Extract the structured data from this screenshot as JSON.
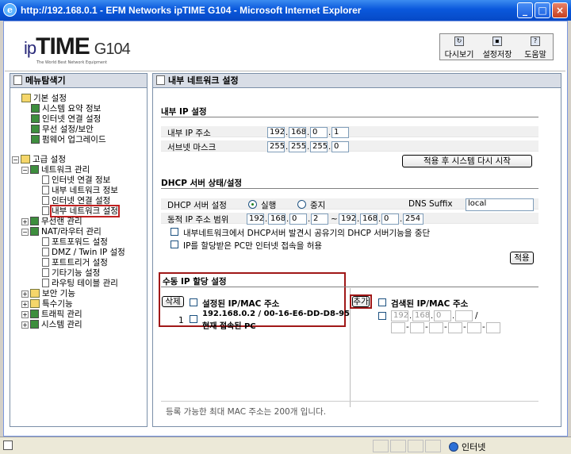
{
  "window": {
    "title": "http://192.168.0.1 - EFM Networks ipTIME G104 - Microsoft Internet Explorer"
  },
  "header": {
    "logo_prefix": "ip",
    "logo_main": "TIME",
    "logo_model": "G104",
    "logo_tagline": "The World Best Network Equipment",
    "buttons": [
      {
        "label": "다시보기"
      },
      {
        "label": "설정저장"
      },
      {
        "label": "도움말"
      }
    ]
  },
  "sidebar": {
    "title": "메뉴탐색기",
    "basic": {
      "label": "기본 설정",
      "items": [
        "시스템 요약 정보",
        "인터넷 연결 설정",
        "무선 설정/보안",
        "펌웨어 업그레이드"
      ]
    },
    "advanced": {
      "label": "고급 설정"
    },
    "network": {
      "label": "네트워크 관리",
      "items": [
        "인터넷 연결 정보",
        "내부 네트워크 정보",
        "인터넷 연결 설정",
        "내부 네트워크 설정"
      ]
    },
    "groups": [
      "무선랜 관리",
      "NAT/라우터 관리"
    ],
    "nat_items": [
      "포트포워드 설정",
      "DMZ / Twin IP 설정",
      "포트트리거 설정",
      "기타기능 설정",
      "라우팅 테이블 관리"
    ],
    "tail_groups": [
      "보안 기능",
      "특수기능",
      "트래픽 관리",
      "시스템 관리"
    ]
  },
  "main": {
    "title": "내부 네트워크 설정",
    "ip_section": {
      "heading": "내부 IP 설정",
      "ip_label": "내부 IP 주소",
      "ip": [
        "192",
        "168",
        "0",
        "1"
      ],
      "mask_label": "서브넷 마스크",
      "mask": [
        "255",
        "255",
        "255",
        "0"
      ],
      "apply_restart": "적용 후 시스템 다시 시작"
    },
    "dhcp_section": {
      "heading": "DHCP 서버 상태/설정",
      "server_label": "DHCP 서버 설정",
      "run": "실행",
      "stop": "중지",
      "dns_label": "DNS Suffix",
      "dns_value": "local",
      "range_label": "동적 IP 주소 범위",
      "range_start": [
        "192",
        "168",
        "0",
        "2"
      ],
      "range_end": [
        "192",
        "168",
        "0",
        "254"
      ],
      "range_sep": "~",
      "opt1": "내부네트워크에서 DHCP서버 발견시 공유기의 DHCP 서버기능을 중단",
      "opt2": "IP를 할당받은 PC만 인터넷 접속을 허용",
      "apply": "적용"
    },
    "manual_section": {
      "heading": "수동 IP 할당 설정",
      "delete": "삭제",
      "set_header": "설정된 IP/MAC 주소",
      "entry_num": "1",
      "entry_line1": "192.168.0.2 / 00-16-E6-DD-D8-95",
      "entry_line2": "현재 접속된 PC",
      "add": "추가",
      "search_header": "검색된 IP/MAC 주소",
      "search_ip": [
        "192",
        "168",
        "0",
        ""
      ],
      "search_mac": [
        "",
        "",
        "",
        "",
        "",
        ""
      ],
      "slash": "/",
      "footer": "등록 가능한 최대 MAC 주소는 200개 입니다."
    }
  },
  "status": {
    "zone": "인터넷"
  }
}
